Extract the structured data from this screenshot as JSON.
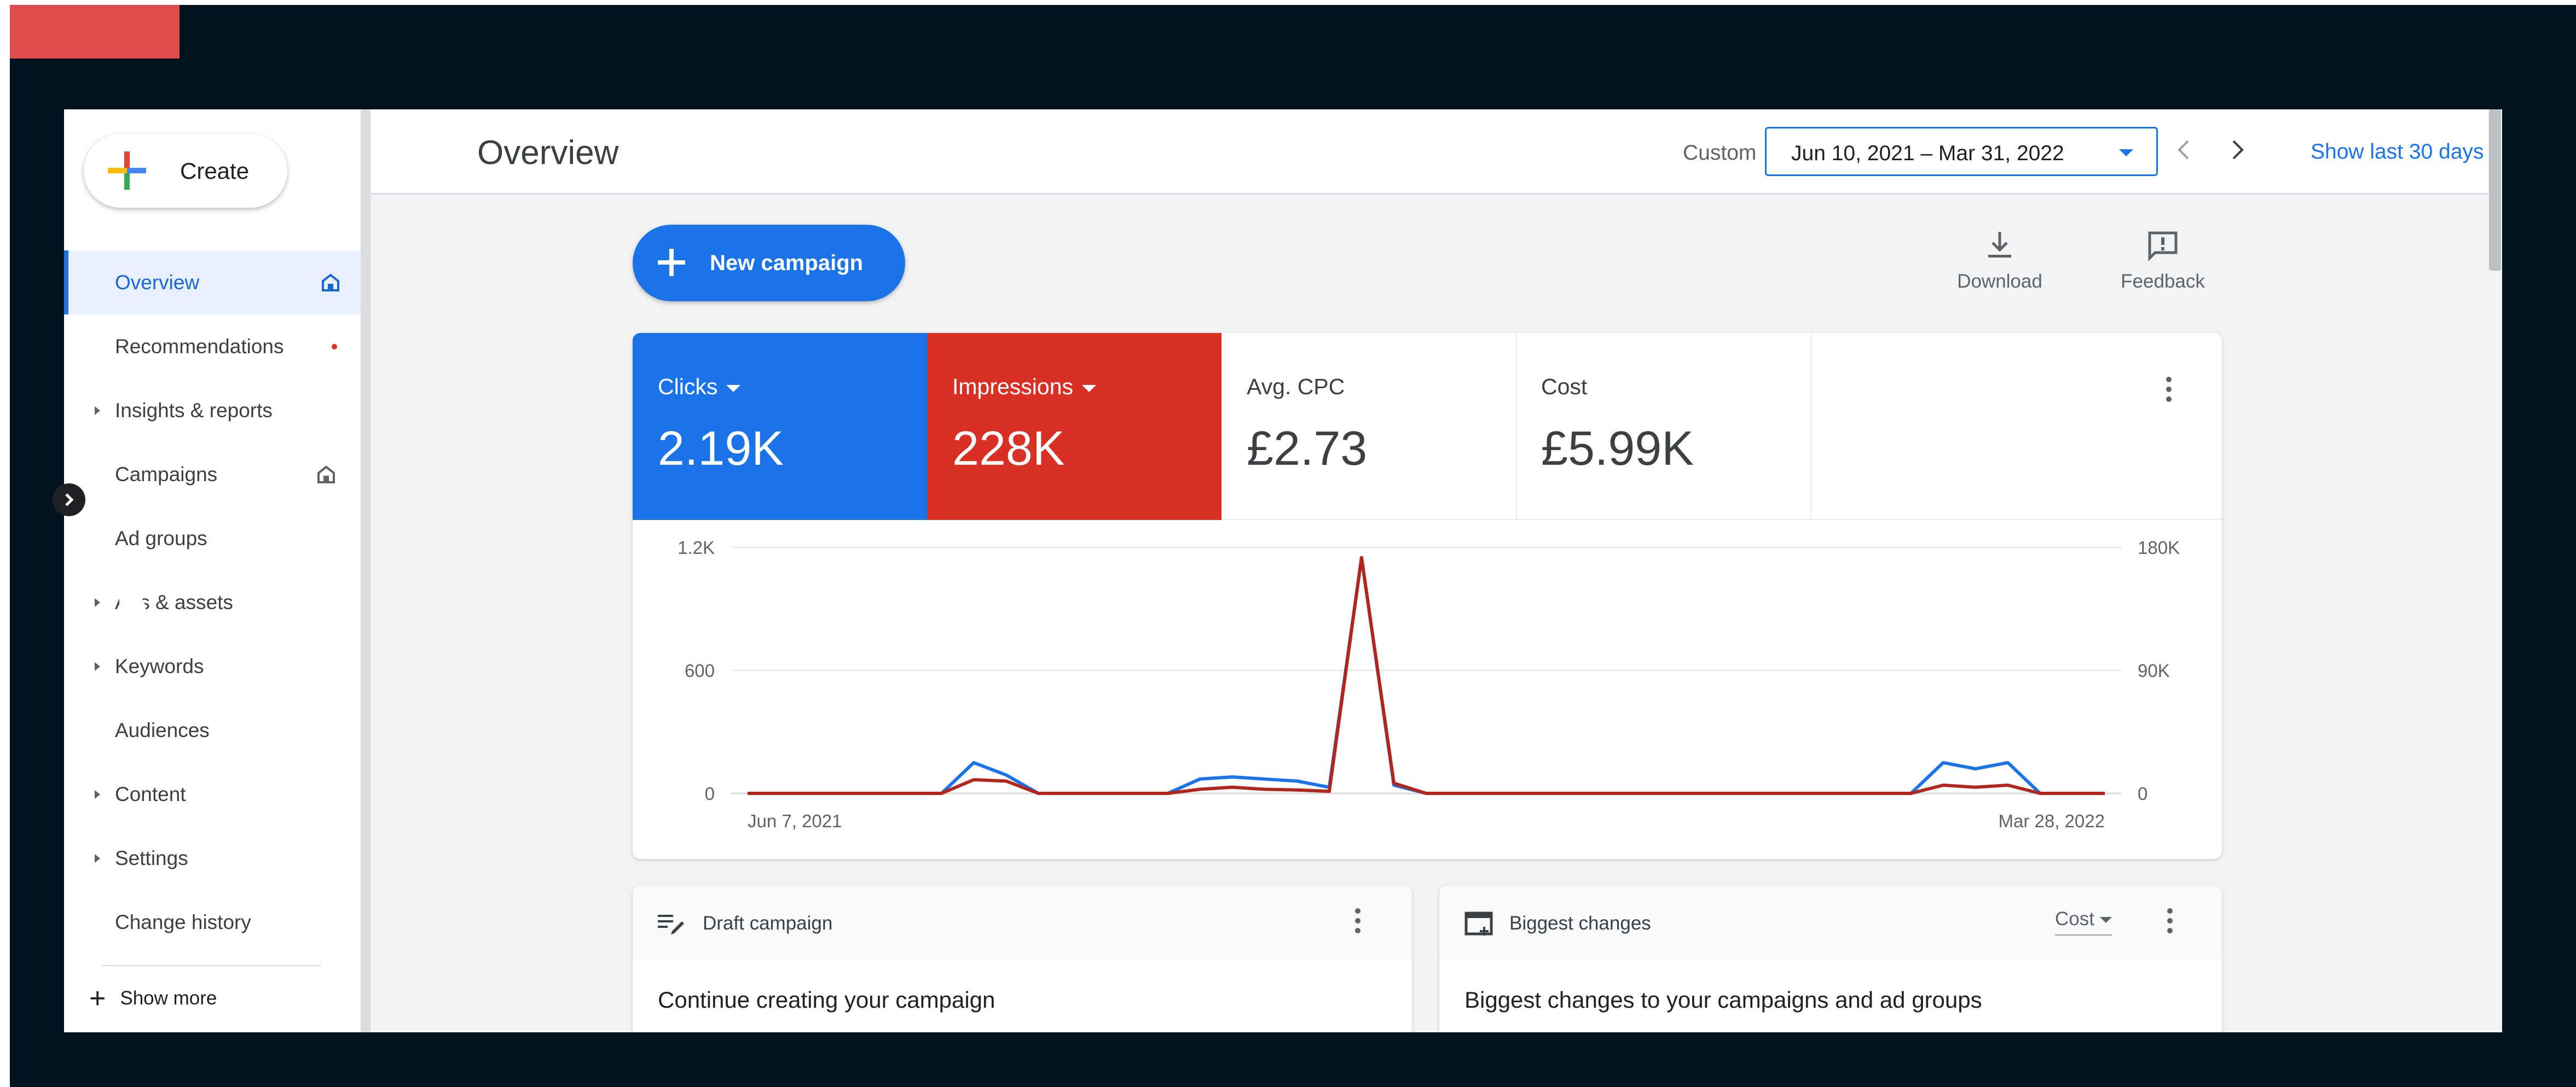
{
  "sidebar": {
    "create_label": "Create",
    "items": [
      {
        "label": "Overview"
      },
      {
        "label": "Recommendations"
      },
      {
        "label": "Insights & reports"
      },
      {
        "label": "Campaigns"
      },
      {
        "label": "Ad groups"
      },
      {
        "label": "Ads & assets"
      },
      {
        "label": "Keywords"
      },
      {
        "label": "Audiences"
      },
      {
        "label": "Content"
      },
      {
        "label": "Settings"
      },
      {
        "label": "Change history"
      }
    ],
    "show_more_label": "Show more"
  },
  "header": {
    "title": "Overview",
    "date_mode_label": "Custom",
    "date_range": "Jun 10, 2021 – Mar 31, 2022",
    "show_last_label": "Show last 30 days"
  },
  "toolbar": {
    "new_campaign_label": "New campaign",
    "download_label": "Download",
    "feedback_label": "Feedback"
  },
  "metrics": [
    {
      "label": "Clicks",
      "value": "2.19K",
      "color": "#1a73e8"
    },
    {
      "label": "Impressions",
      "value": "228K",
      "color": "#d93025"
    },
    {
      "label": "Avg. CPC",
      "value": "£2.73"
    },
    {
      "label": "Cost",
      "value": "£5.99K"
    }
  ],
  "chart_data": {
    "type": "line",
    "x_labels": [
      "Jun 7, 2021",
      "Mar 28, 2022"
    ],
    "left_ticks": [
      "1.2K",
      "600",
      "0"
    ],
    "right_ticks": [
      "180K",
      "90K",
      "0"
    ],
    "y_left_lim": [
      0,
      1200
    ],
    "y_right_lim": [
      0,
      180000
    ],
    "grid": true,
    "series": [
      {
        "name": "Clicks",
        "color": "#1a73e8",
        "axis": "left",
        "values": [
          0,
          0,
          0,
          0,
          0,
          0,
          0,
          150,
          90,
          0,
          0,
          0,
          0,
          0,
          70,
          80,
          70,
          60,
          30,
          1150,
          40,
          0,
          0,
          0,
          0,
          0,
          0,
          0,
          0,
          0,
          0,
          0,
          0,
          0,
          0,
          0,
          0,
          150,
          120,
          150,
          0,
          0,
          0
        ]
      },
      {
        "name": "Impressions",
        "color": "#b3261e",
        "axis": "right",
        "values": [
          0,
          0,
          0,
          0,
          0,
          0,
          0,
          10000,
          9000,
          0,
          0,
          0,
          0,
          0,
          3000,
          4500,
          3000,
          2500,
          1500,
          172500,
          7500,
          0,
          0,
          0,
          0,
          0,
          0,
          0,
          0,
          0,
          0,
          0,
          0,
          0,
          0,
          0,
          0,
          6000,
          4500,
          6000,
          0,
          0,
          0
        ]
      }
    ]
  },
  "cards": {
    "draft": {
      "title": "Draft campaign",
      "body": "Continue creating your campaign"
    },
    "biggest": {
      "title": "Biggest changes",
      "dropdown": "Cost",
      "body": "Biggest changes to your campaigns and ad groups"
    }
  }
}
